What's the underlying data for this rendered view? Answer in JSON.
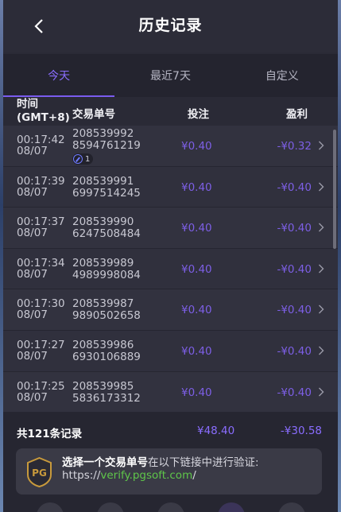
{
  "header": {
    "title": "历史记录"
  },
  "tabs": [
    {
      "label": "今天",
      "active": true
    },
    {
      "label": "最近7天",
      "active": false
    },
    {
      "label": "自定义",
      "active": false
    }
  ],
  "columns": {
    "time": "时间",
    "timezone": "(GMT+8)",
    "order": "交易单号",
    "bet": "投注",
    "profit": "盈利"
  },
  "rows": [
    {
      "time": "00:17:42",
      "date": "08/07",
      "order_a": "208539992",
      "order_b": "8594761219",
      "bet": "¥0.40",
      "profit": "-¥0.32",
      "badge": "1"
    },
    {
      "time": "00:17:39",
      "date": "08/07",
      "order_a": "208539991",
      "order_b": "6997514245",
      "bet": "¥0.40",
      "profit": "-¥0.40"
    },
    {
      "time": "00:17:37",
      "date": "08/07",
      "order_a": "208539990",
      "order_b": "6247508484",
      "bet": "¥0.40",
      "profit": "-¥0.40"
    },
    {
      "time": "00:17:34",
      "date": "08/07",
      "order_a": "208539989",
      "order_b": "4989998084",
      "bet": "¥0.40",
      "profit": "-¥0.40"
    },
    {
      "time": "00:17:30",
      "date": "08/07",
      "order_a": "208539987",
      "order_b": "9890502658",
      "bet": "¥0.40",
      "profit": "-¥0.40"
    },
    {
      "time": "00:17:27",
      "date": "08/07",
      "order_a": "208539986",
      "order_b": "6930106889",
      "bet": "¥0.40",
      "profit": "-¥0.40"
    },
    {
      "time": "00:17:25",
      "date": "08/07",
      "order_a": "208539985",
      "order_b": "5836173312",
      "bet": "¥0.40",
      "profit": "-¥0.40"
    }
  ],
  "summary": {
    "count": "共121条记录",
    "bet_total": "¥48.40",
    "profit_total": "-¥30.58"
  },
  "verify": {
    "strong": "选择一个交易单号",
    "rest": "在以下链接中进行验证:",
    "url_prefix": "https://",
    "url_domain": "verify.pgsoft.com",
    "url_suffix": "/",
    "logo_text": "PG"
  },
  "colors": {
    "accent": "#7d5fe6",
    "link": "#5fc64a",
    "background": "#2a2a36"
  }
}
